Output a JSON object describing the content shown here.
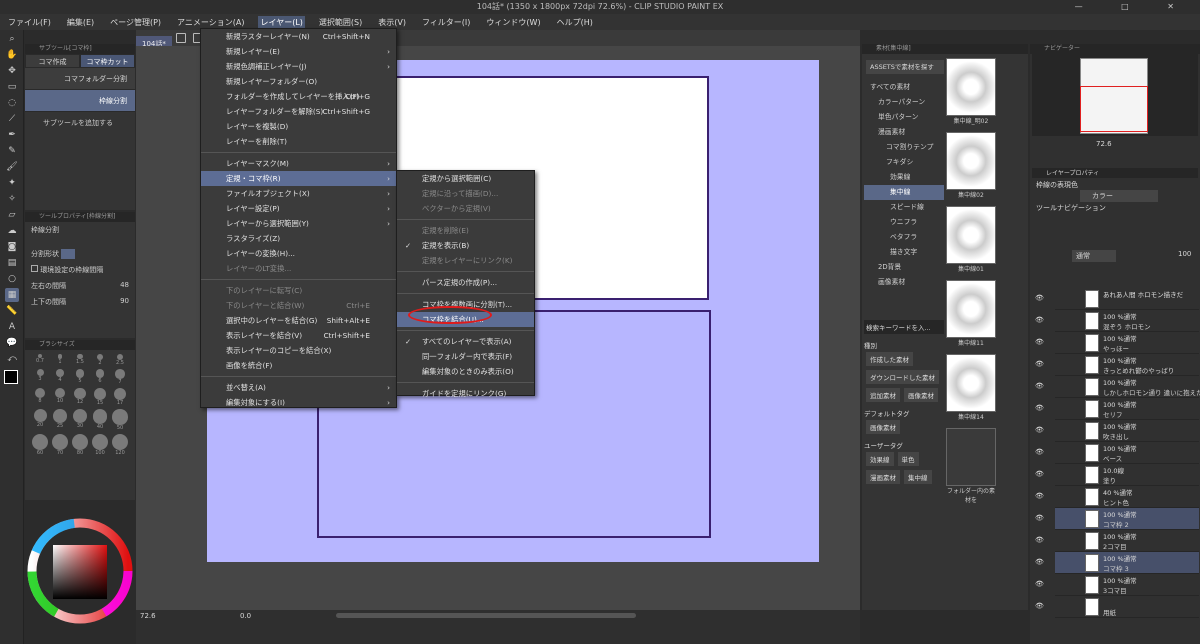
{
  "window": {
    "title": "104話* (1350 x 1800px 72dpi 72.6%) - CLIP STUDIO PAINT EX",
    "controls": [
      "—",
      "□",
      "✕"
    ]
  },
  "menubar": [
    {
      "label": "ファイル(F)",
      "active": false
    },
    {
      "label": "編集(E)",
      "active": false
    },
    {
      "label": "ページ管理(P)",
      "active": false
    },
    {
      "label": "アニメーション(A)",
      "active": false
    },
    {
      "label": "レイヤー(L)",
      "active": true
    },
    {
      "label": "選択範囲(S)",
      "active": false
    },
    {
      "label": "表示(V)",
      "active": false
    },
    {
      "label": "フィルター(I)",
      "active": false
    },
    {
      "label": "ウィンドウ(W)",
      "active": false
    },
    {
      "label": "ヘルプ(H)",
      "active": false
    }
  ],
  "doc_tab": "104話*",
  "subtool": {
    "title": "サブツール[コマ枠]",
    "tabs": [
      "コマ作成",
      "コマ枠カット"
    ],
    "items": [
      "コマフォルダー分割",
      "枠線分割"
    ],
    "add": "サブツールを追加する"
  },
  "toolprop": {
    "title": "ツールプロパティ[枠線分割]",
    "name": "枠線分割",
    "shape_label": "分割形状",
    "env_label": "環境設定の枠線間隔",
    "lr_label": "左右の間隔",
    "lr_value": "48",
    "ud_label": "上下の間隔",
    "ud_value": "90"
  },
  "brush": {
    "title": "ブラシサイズ",
    "sizes": [
      "0.7",
      "1",
      "1.5",
      "2",
      "2.5",
      "3",
      "4",
      "5",
      "6",
      "7",
      "8",
      "10",
      "12",
      "15",
      "17",
      "20",
      "25",
      "30",
      "40",
      "50",
      "60",
      "70",
      "80",
      "100",
      "120",
      "150",
      "170",
      "200",
      "250",
      "300",
      "400",
      "500",
      "600",
      "700",
      "800",
      "1000",
      "1200",
      "1500",
      "1700",
      "2000"
    ]
  },
  "menu_layer": [
    {
      "label": "新規ラスターレイヤー(N)",
      "shortcut": "Ctrl+Shift+N"
    },
    {
      "label": "新規レイヤー(E)",
      "arrow": true
    },
    {
      "label": "新規色調補正レイヤー(J)",
      "arrow": true
    },
    {
      "label": "新規レイヤーフォルダー(O)"
    },
    {
      "label": "フォルダーを作成してレイヤーを挿入(F)",
      "shortcut": "Ctrl+G"
    },
    {
      "label": "レイヤーフォルダーを解除(S)",
      "shortcut": "Ctrl+Shift+G"
    },
    {
      "label": "レイヤーを複製(D)"
    },
    {
      "label": "レイヤーを削除(T)"
    },
    {
      "sep": true
    },
    {
      "label": "レイヤーマスク(M)",
      "arrow": true
    },
    {
      "label": "定規・コマ枠(R)",
      "arrow": true,
      "hl": true
    },
    {
      "label": "ファイルオブジェクト(X)",
      "arrow": true
    },
    {
      "label": "レイヤー設定(P)",
      "arrow": true
    },
    {
      "label": "レイヤーから選択範囲(Y)",
      "arrow": true
    },
    {
      "label": "ラスタライズ(Z)"
    },
    {
      "label": "レイヤーの変換(H)..."
    },
    {
      "label": "レイヤーのLT変換...",
      "dis": true
    },
    {
      "sep": true
    },
    {
      "label": "下のレイヤーに転写(C)",
      "dis": true
    },
    {
      "label": "下のレイヤーと結合(W)",
      "shortcut": "Ctrl+E",
      "dis": true
    },
    {
      "label": "選択中のレイヤーを結合(G)",
      "shortcut": "Shift+Alt+E"
    },
    {
      "label": "表示レイヤーを結合(V)",
      "shortcut": "Ctrl+Shift+E"
    },
    {
      "label": "表示レイヤーのコピーを結合(X)"
    },
    {
      "label": "画像を統合(F)"
    },
    {
      "sep": true
    },
    {
      "label": "並べ替え(A)",
      "arrow": true
    },
    {
      "label": "編集対象にする(I)",
      "arrow": true
    }
  ],
  "menu_ruler": [
    {
      "label": "定規から選択範囲(C)"
    },
    {
      "label": "定規に沿って描画(D)...",
      "dis": true
    },
    {
      "label": "ベクターから定規(V)",
      "dis": true
    },
    {
      "sep": true
    },
    {
      "label": "定規を削除(E)",
      "dis": true
    },
    {
      "label": "定規を表示(B)",
      "check": true
    },
    {
      "label": "定規をレイヤーにリンク(K)",
      "dis": true
    },
    {
      "sep": true
    },
    {
      "label": "パース定規の作成(P)..."
    },
    {
      "sep": true
    },
    {
      "label": "コマ枠を複数画に分割(T)..."
    },
    {
      "label": "コマ枠を結合(U)...",
      "hl": true
    },
    {
      "sep": true
    },
    {
      "label": "すべてのレイヤーで表示(A)",
      "check": true
    },
    {
      "label": "同一フォルダー内で表示(F)"
    },
    {
      "label": "編集対象のときのみ表示(O)"
    },
    {
      "sep": true
    },
    {
      "label": "ガイドを定規にリンク(G)"
    }
  ],
  "materials": {
    "title": "素材[集中線]",
    "assets_btn": "ASSETSで素材を探す",
    "tree": [
      {
        "label": "すべての素材",
        "sel": false
      },
      {
        "label": "カラーパターン",
        "sel": false
      },
      {
        "label": "単色パターン",
        "sel": false
      },
      {
        "label": "漫画素材",
        "sel": false
      },
      {
        "label": "コマ割りテンプ",
        "sel": false
      },
      {
        "label": "フキダシ",
        "sel": false
      },
      {
        "label": "効果線",
        "sel": false
      },
      {
        "label": "集中線",
        "sel": true
      },
      {
        "label": "スピード線",
        "sel": false
      },
      {
        "label": "ウニフラ",
        "sel": false
      },
      {
        "label": "ベタフラ",
        "sel": false
      },
      {
        "label": "描き文字",
        "sel": false
      },
      {
        "label": "2D背景",
        "sel": false
      },
      {
        "label": "画像素材",
        "sel": false
      }
    ],
    "thumbs": [
      "集中線_明02",
      "集中線02",
      "集中線01",
      "集中線11",
      "集中線14",
      "フォルダー内の素材を"
    ],
    "search_placeholder": "検索キーワードを入...",
    "kind_label": "種別",
    "kind_tags": [
      "作成した素材",
      "ダウンロードした素材",
      "追加素材",
      "画像素材"
    ],
    "default_label": "デフォルトタグ",
    "default_tags": [
      "画像素材"
    ],
    "user_label": "ユーザータグ",
    "user_tags": [
      "効果線",
      "単色",
      "漫画素材",
      "集中線"
    ]
  },
  "navigator": {
    "title": "ナビゲーター",
    "zoom": "72.6"
  },
  "layer_prop": {
    "title": "レイヤープロパティ",
    "frame_label": "枠線の表現色",
    "color_value": "カラー",
    "toolnav": "ツールナビゲーション"
  },
  "layers": {
    "blend": "通常",
    "opacity": "100",
    "rows": [
      {
        "name": "あれあ人間 ホロモン描きだ",
        "sub": "",
        "sel": false
      },
      {
        "name": "100 %通常",
        "sub": "混ぞう ホロモン",
        "sel": false
      },
      {
        "name": "100 %通常",
        "sub": "やっほー",
        "sel": false
      },
      {
        "name": "100 %通常",
        "sub": "きっとめれ鬱のやっばり",
        "sel": false
      },
      {
        "name": "100 %通常",
        "sub": "しかしホロモン通り 違いに抱えた",
        "sel": false
      },
      {
        "name": "100 %通常",
        "sub": "セリフ",
        "sel": false
      },
      {
        "name": "100 %通常",
        "sub": "吹き出し",
        "sel": false
      },
      {
        "name": "100 %通常",
        "sub": "ベース",
        "sel": false
      },
      {
        "name": "10.0線",
        "sub": "塗り",
        "sel": false
      },
      {
        "name": "40 %通常",
        "sub": "ヒント色",
        "sel": false
      },
      {
        "name": "100 %通常",
        "sub": "コマ枠 2",
        "sel": true
      },
      {
        "name": "100 %通常",
        "sub": "2コマ目",
        "sel": false
      },
      {
        "name": "100 %通常",
        "sub": "コマ枠 3",
        "sel": true
      },
      {
        "name": "100 %通常",
        "sub": "3コマ目",
        "sel": false
      },
      {
        "name": "",
        "sub": "用紙",
        "sel": false
      }
    ]
  },
  "status": {
    "zoom": "72.6",
    "zero": "0.0"
  }
}
